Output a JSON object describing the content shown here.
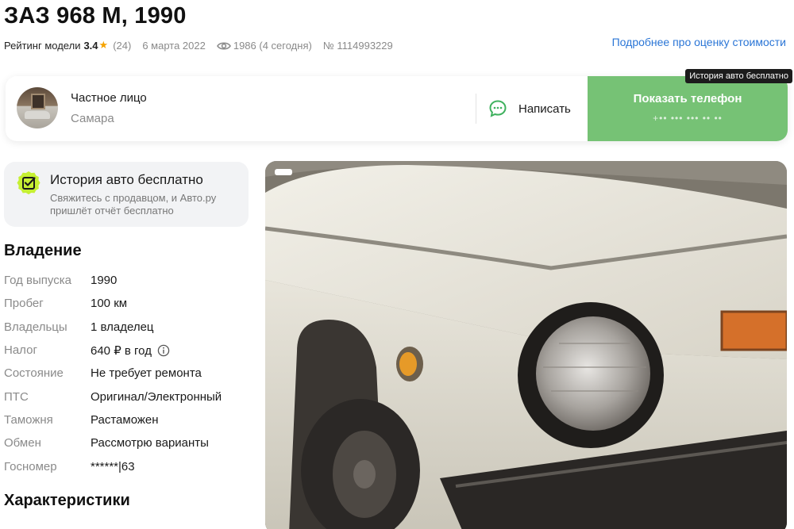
{
  "listing": {
    "title": "ЗАЗ 968 М, 1990",
    "rating_label": "Рейтинг модели",
    "rating_value": "3.4",
    "rating_count": "(24)",
    "date": "6 марта 2022",
    "views": "1986 (4 сегодня)",
    "number": "№ 1114993229",
    "price_link": "Подробнее про оценку стоимости"
  },
  "tooltip": "История авто бесплатно",
  "seller": {
    "name": "Частное лицо",
    "city": "Самара",
    "write_label": "Написать",
    "phone_label": "Показать телефон",
    "phone_mask": "+•• ••• ••• •• ••"
  },
  "history": {
    "title": "История авто бесплатно",
    "subtitle": "Свяжитесь с продавцом, и Авто.ру пришлёт отчёт бесплатно"
  },
  "ownership": {
    "title": "Владение",
    "rows": [
      {
        "label": "Год выпуска",
        "value": "1990"
      },
      {
        "label": "Пробег",
        "value": "100 км"
      },
      {
        "label": "Владельцы",
        "value": "1 владелец"
      },
      {
        "label": "Налог",
        "value": "640 ₽ в год"
      },
      {
        "label": "Состояние",
        "value": "Не требует ремонта"
      },
      {
        "label": "ПТС",
        "value": "Оригинал/Электронный"
      },
      {
        "label": "Таможня",
        "value": "Растаможен"
      },
      {
        "label": "Обмен",
        "value": "Рассмотрю варианты"
      },
      {
        "label": "Госномер",
        "value": "******|63"
      }
    ]
  },
  "characteristics": {
    "title": "Характеристики"
  },
  "icons": {
    "star": "star-icon",
    "views": "eye-icon",
    "chat": "chat-bubble-icon",
    "history": "checkbox-badge-icon",
    "info": "info-icon"
  },
  "colors": {
    "accent_green": "#76c275",
    "link_blue": "#2a75d6",
    "star": "#f5a300",
    "history_badge": "#c6f033"
  }
}
